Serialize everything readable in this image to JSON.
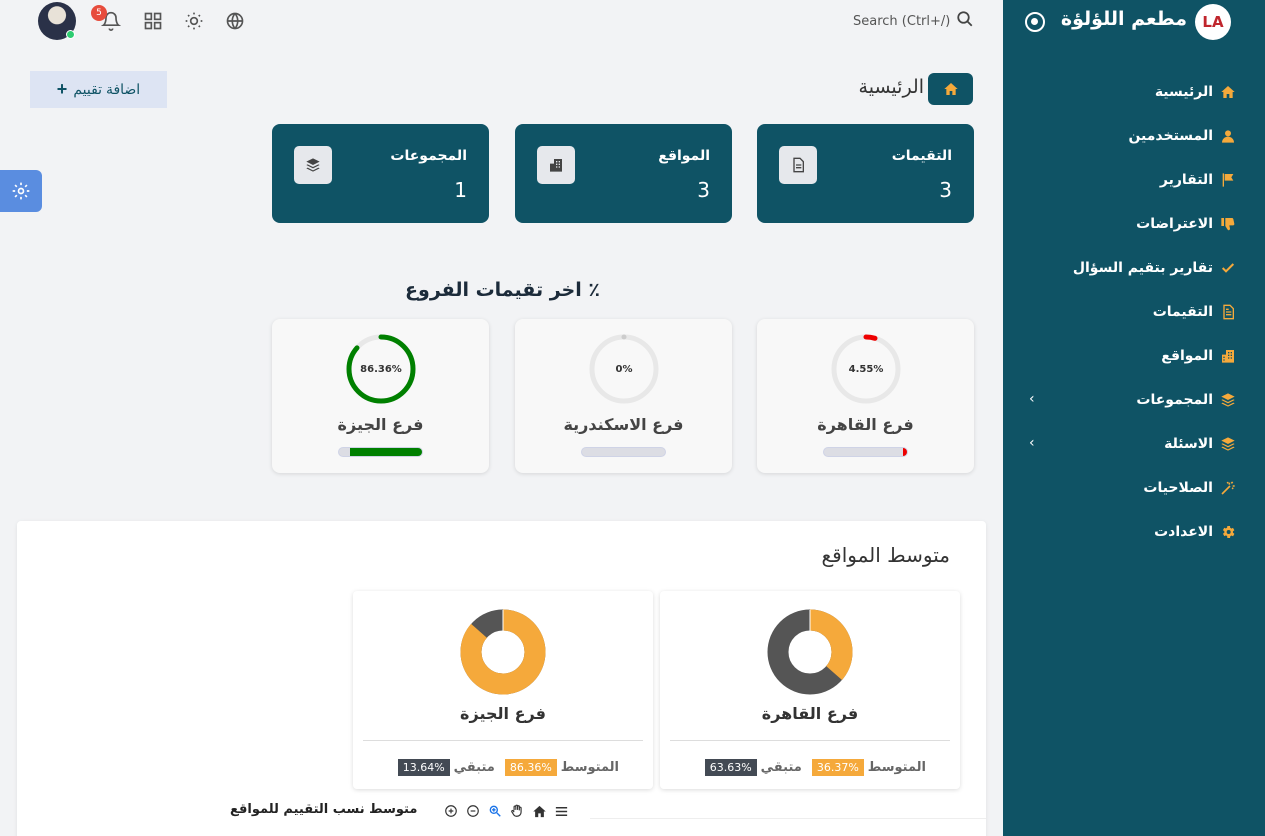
{
  "brand": {
    "title": "مطعم اللؤلؤة",
    "logo_text": "LA"
  },
  "sidebar": {
    "items": [
      {
        "label": "الرئيسية",
        "icon": "home-icon",
        "has_children": false
      },
      {
        "label": "المستخدمين",
        "icon": "user-icon",
        "has_children": false
      },
      {
        "label": "التقارير",
        "icon": "flag-icon",
        "has_children": false
      },
      {
        "label": "الاعتراضات",
        "icon": "thumbs-down-icon",
        "has_children": false
      },
      {
        "label": "تقارير بتقيم السؤال",
        "icon": "check-icon",
        "has_children": false
      },
      {
        "label": "التقيمات",
        "icon": "document-icon",
        "has_children": false
      },
      {
        "label": "المواقع",
        "icon": "building-icon",
        "has_children": false
      },
      {
        "label": "المجموعات",
        "icon": "layers-icon",
        "has_children": true
      },
      {
        "label": "الاسئلة",
        "icon": "layers-icon",
        "has_children": true
      },
      {
        "label": "الصلاحيات",
        "icon": "magic-wand-icon",
        "has_children": false
      },
      {
        "label": "الاعدادت",
        "icon": "gear-icon",
        "has_children": false
      }
    ]
  },
  "topbar": {
    "search_label": "Search (Ctrl+/)",
    "notification_count": "5"
  },
  "page": {
    "title": "الرئيسية",
    "add_button": "اضافة تقييم"
  },
  "stats": [
    {
      "label": "التقيمات",
      "value": "3",
      "icon": "document-icon"
    },
    {
      "label": "المواقع",
      "value": "3",
      "icon": "building-icon"
    },
    {
      "label": "المجموعات",
      "value": "1",
      "icon": "layers-icon"
    }
  ],
  "branches_section": {
    "title": "٪ اخر تقيمات الفروع",
    "branches": [
      {
        "name": "فرع القاهرة",
        "percent_label": "4.55%",
        "value": 4.55,
        "color": "#ee0000"
      },
      {
        "name": "فرع الاسكندرية",
        "percent_label": "0%",
        "value": 0,
        "color": "#cccccc"
      },
      {
        "name": "فرع الجيزة",
        "percent_label": "86.36%",
        "value": 86.36,
        "color": "#008000"
      }
    ]
  },
  "sites_avg": {
    "title": "متوسط المواقع",
    "avg_label": "المتوسط",
    "remaining_label": "متبقي",
    "cards": [
      {
        "name": "فرع القاهرة",
        "avg": "36.37%",
        "remaining": "63.63%",
        "avg_value": 36.37
      },
      {
        "name": "فرع الجيزة",
        "avg": "86.36%",
        "remaining": "13.64%",
        "avg_value": 86.36
      }
    ]
  },
  "chart2": {
    "title": "متوسط نسب التقييم للمواقع"
  },
  "colors": {
    "primary": "#0f5365",
    "accent": "#f5a93b",
    "dark": "#555555"
  }
}
